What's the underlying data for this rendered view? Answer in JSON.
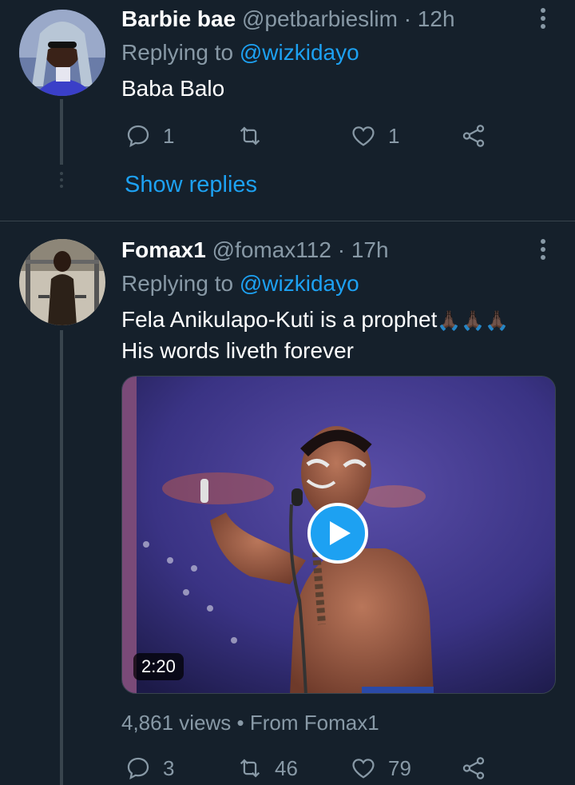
{
  "tweets": [
    {
      "name": "Barbie bae",
      "handle": "@petbarbieslim",
      "separator": "·",
      "time": "12h",
      "replying_prefix": "Replying to",
      "replying_to": "@wizkidayo",
      "text": "Baba Balo",
      "reply_count": "1",
      "retweet_count": "",
      "like_count": "1",
      "show_replies": "Show replies"
    },
    {
      "name": "Fomax1",
      "handle": "@fomax112",
      "separator": "·",
      "time": "17h",
      "replying_prefix": "Replying to",
      "replying_to": "@wizkidayo",
      "text_line1": "Fela Anikulapo-Kuti is a prophet",
      "emoji": "🙏🏿🙏🏿🙏🏿",
      "text_line2": "His words liveth forever",
      "video_duration": "2:20",
      "views": "4,861 views",
      "views_sep": "•",
      "from": "From Fomax1",
      "reply_count": "3",
      "retweet_count": "46",
      "like_count": "79"
    }
  ],
  "colors": {
    "background": "#15202b",
    "accent": "#1da1f2",
    "muted": "#8899a6",
    "divider": "#38444d"
  }
}
